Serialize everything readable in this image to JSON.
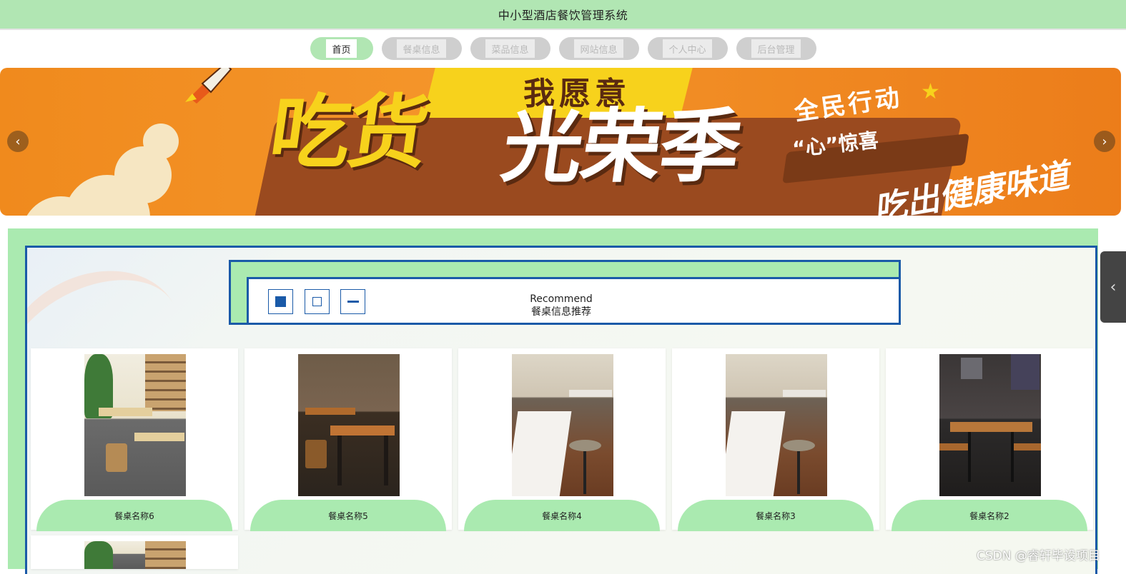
{
  "header": {
    "title": "中小型酒店餐饮管理系统"
  },
  "nav": {
    "items": [
      {
        "label": "首页",
        "active": true
      },
      {
        "label": "餐桌信息",
        "active": false
      },
      {
        "label": "菜品信息",
        "active": false
      },
      {
        "label": "网站信息",
        "active": false
      },
      {
        "label": "个人中心",
        "active": false
      },
      {
        "label": "后台管理",
        "active": false
      }
    ]
  },
  "banner": {
    "top_text": "我愿意",
    "big_text_1": "吃货",
    "big_text_2": "光荣季",
    "right_text": "全民行动",
    "surprise_text": "“心”惊喜",
    "bottom_text": "吃出健康味道",
    "prev_icon": "chevron-left-icon",
    "next_icon": "chevron-right-icon"
  },
  "recommend": {
    "title_en": "Recommend",
    "title_cn": "餐桌信息推荐"
  },
  "cards": [
    {
      "name": "餐桌名称6"
    },
    {
      "name": "餐桌名称5"
    },
    {
      "name": "餐桌名称4"
    },
    {
      "name": "餐桌名称3"
    },
    {
      "name": "餐桌名称2"
    }
  ],
  "side_tab": {
    "icon": "chevron-left-icon"
  },
  "watermark": "CSDN @睿轩毕设项目",
  "colors": {
    "accent_green": "#aaeab0",
    "accent_blue": "#1a5aa8",
    "banner_orange": "#f08a1d"
  }
}
